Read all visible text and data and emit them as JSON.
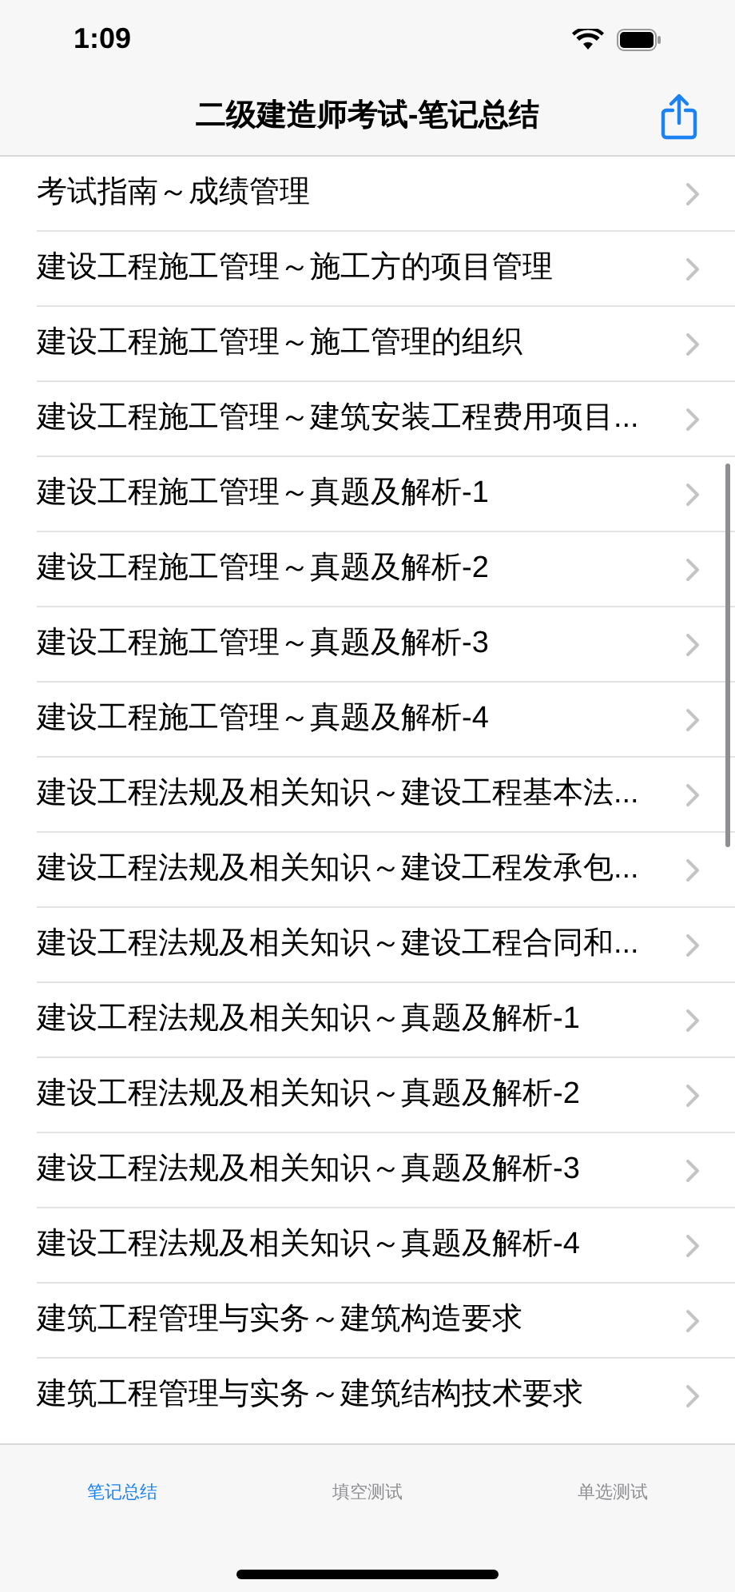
{
  "status_bar": {
    "time": "1:09"
  },
  "nav_bar": {
    "title": "二级建造师考试-笔记总结"
  },
  "list": [
    {
      "label": "考试指南～成绩管理"
    },
    {
      "label": "建设工程施工管理～施工方的项目管理"
    },
    {
      "label": "建设工程施工管理～施工管理的组织"
    },
    {
      "label": "建设工程施工管理～建筑安装工程费用项目..."
    },
    {
      "label": "建设工程施工管理～真题及解析-1"
    },
    {
      "label": "建设工程施工管理～真题及解析-2"
    },
    {
      "label": "建设工程施工管理～真题及解析-3"
    },
    {
      "label": "建设工程施工管理～真题及解析-4"
    },
    {
      "label": "建设工程法规及相关知识～建设工程基本法..."
    },
    {
      "label": "建设工程法规及相关知识～建设工程发承包..."
    },
    {
      "label": "建设工程法规及相关知识～建设工程合同和..."
    },
    {
      "label": "建设工程法规及相关知识～真题及解析-1"
    },
    {
      "label": "建设工程法规及相关知识～真题及解析-2"
    },
    {
      "label": "建设工程法规及相关知识～真题及解析-3"
    },
    {
      "label": "建设工程法规及相关知识～真题及解析-4"
    },
    {
      "label": "建筑工程管理与实务～建筑构造要求"
    },
    {
      "label": "建筑工程管理与实务～建筑结构技术要求"
    }
  ],
  "tab_bar": [
    {
      "label": "笔记总结",
      "selected": true
    },
    {
      "label": "填空测试",
      "selected": false
    },
    {
      "label": "单选测试",
      "selected": false
    }
  ]
}
